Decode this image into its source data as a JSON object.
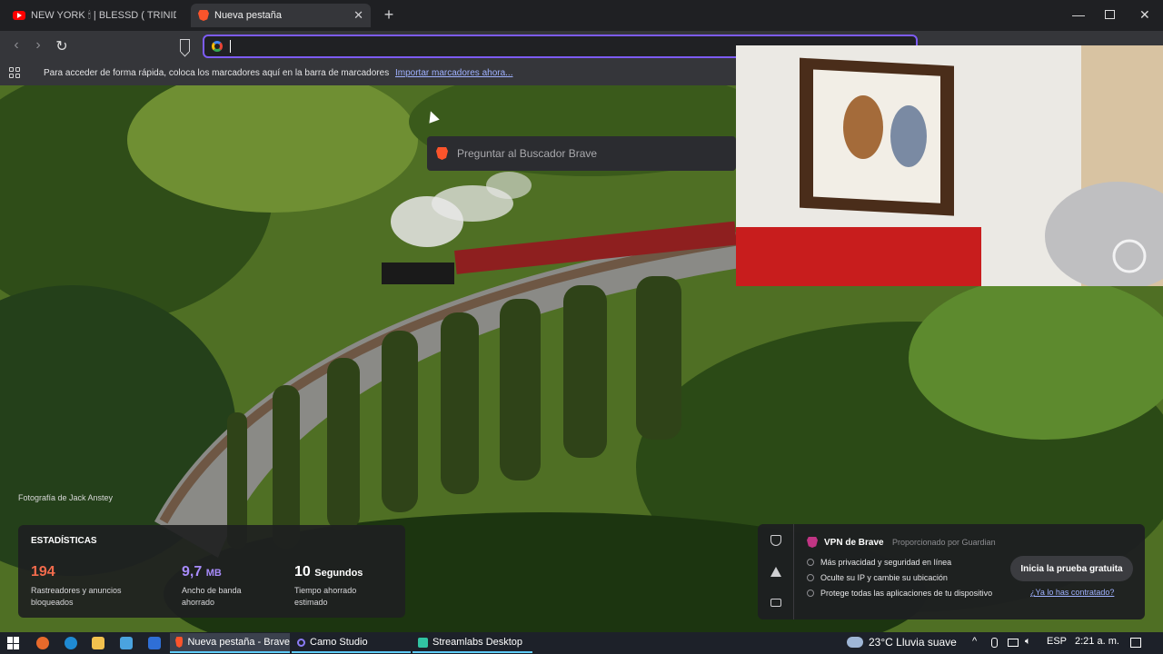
{
  "tabs": [
    {
      "title": "NEW YORK 🕯 | BLESSD ( TRINID",
      "active": false
    },
    {
      "title": "Nueva pestaña",
      "active": true
    }
  ],
  "bookmarks_bar": {
    "message": "Para acceder de forma rápida, coloca los marcadores aquí en la barra de marcadores",
    "link": "Importar marcadores ahora..."
  },
  "address_bar": {
    "value": ""
  },
  "suggestion": {
    "text": "Preguntar al Buscador Brave"
  },
  "photo_credit": "Fotografía de Jack Anstey",
  "stats": {
    "title": "ESTADÍSTICAS",
    "items": [
      {
        "value": "194",
        "unit": "",
        "label1": "Rastreadores y anuncios",
        "label2": "bloqueados",
        "color": "#f26b4c"
      },
      {
        "value": "9,7",
        "unit": "MB",
        "label1": "Ancho de banda",
        "label2": "ahorrado",
        "color": "#a78bfa"
      },
      {
        "value": "10",
        "unit": "Segundos",
        "label1": "Tiempo ahorrado",
        "label2": "estimado",
        "color": "#ffffff"
      }
    ]
  },
  "vpn": {
    "title": "VPN de Brave",
    "provider": "Proporcionado por  Guardian",
    "features": [
      "Más privacidad y seguridad en línea",
      "Oculte su IP y cambie su ubicación",
      "Protege todas las aplicaciones de tu dispositivo"
    ],
    "cta": "Inicia la prueba gratuita",
    "link": "¿Ya lo has contratado?"
  },
  "taskbar": {
    "apps": [
      {
        "label": "Nueva pestaña - Brave",
        "active": true
      },
      {
        "label": "Camo Studio",
        "active": false
      },
      {
        "label": "Streamlabs Desktop",
        "active": false
      }
    ],
    "weather": "23°C  Lluvia suave",
    "lang": "ESP",
    "time": "2:21 a. m."
  }
}
